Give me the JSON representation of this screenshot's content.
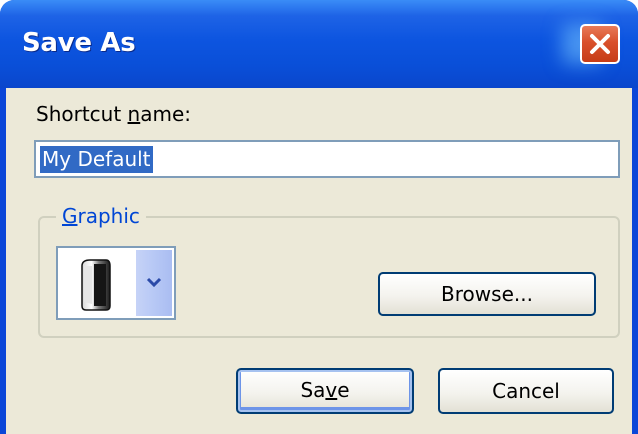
{
  "window": {
    "title": "Save As"
  },
  "shortcut": {
    "label_pre": "Shortcut ",
    "label_accel": "n",
    "label_post": "ame:",
    "value": "My Default"
  },
  "graphic": {
    "label_accel": "G",
    "label_post": "raphic",
    "selected_icon": "shortcut-graphic-icon"
  },
  "buttons": {
    "browse_label": "Browse...",
    "save_pre": "Sa",
    "save_accel": "v",
    "save_post": "e",
    "cancel_label": "Cancel"
  },
  "colors": {
    "titlebar": "#0a4fd8",
    "close_button": "#d9502b",
    "dialog_face": "#ece9d8",
    "selection": "#316ac5",
    "groupbox_label": "#0046d5"
  }
}
